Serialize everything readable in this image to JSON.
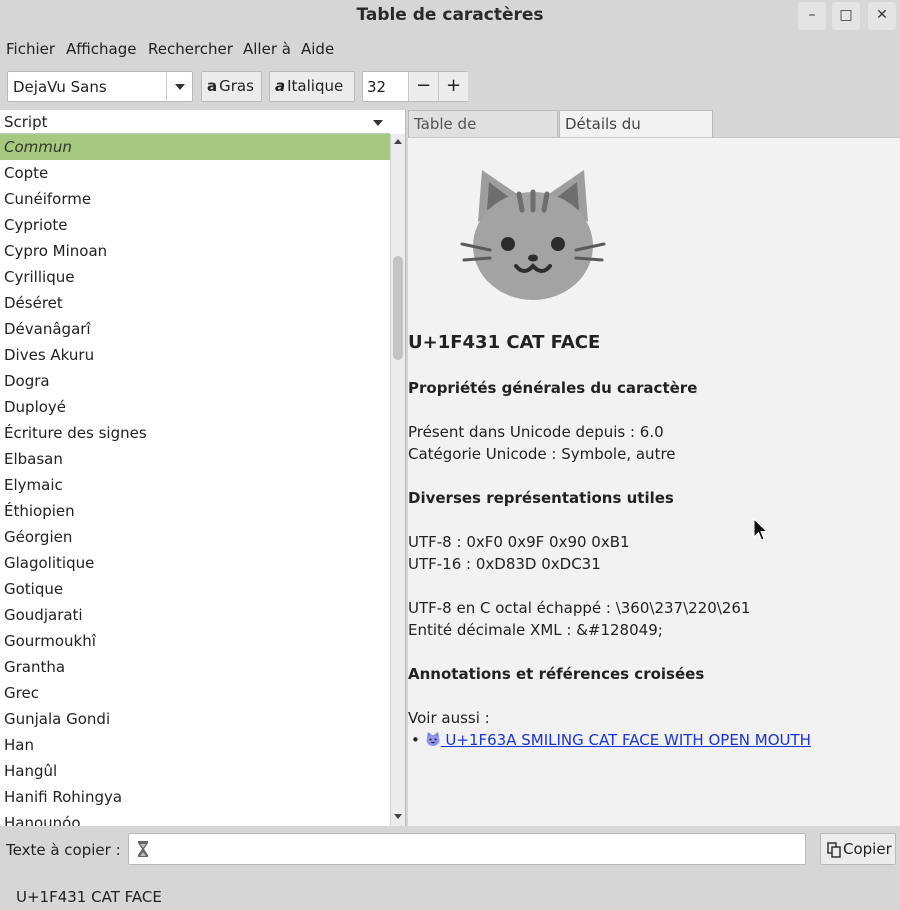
{
  "window": {
    "title": "Table de caractères",
    "controls": {
      "minimize": "–",
      "maximize": "□",
      "close": "✕"
    }
  },
  "menu": [
    "Fichier",
    "Affichage",
    "Rechercher",
    "Aller à",
    "Aide"
  ],
  "toolbar": {
    "font": "DejaVu Sans",
    "bold_label": "Gras",
    "italic_label": "Italique",
    "bold_icon_text": "a",
    "italic_icon_text": "a",
    "size": "32",
    "decrement": "−",
    "increment": "+"
  },
  "sidebar": {
    "header": "Script",
    "items": [
      "Commun",
      "Copte",
      "Cunéiforme",
      "Cypriote",
      "Cypro Minoan",
      "Cyrillique",
      "Déséret",
      "Dévanâgarî",
      "Dives Akuru",
      "Dogra",
      "Duployé",
      "Écriture des signes",
      "Elbasan",
      "Elymaic",
      "Éthiopien",
      "Géorgien",
      "Glagolitique",
      "Gotique",
      "Goudjarati",
      "Gourmoukhî",
      "Grantha",
      "Grec",
      "Gunjala Gondi",
      "Han",
      "Hangûl",
      "Hanifi Rohingya",
      "Hanounóo"
    ],
    "selected_index": 0,
    "selected_color": "#a7c880"
  },
  "tabs": [
    "Table de caractères",
    "Détails du caractère"
  ],
  "details": {
    "glyph_icon": "cat-face-icon",
    "char_title": "U+1F431 CAT FACE",
    "general_heading": "Propriétés générales du caractère",
    "unicode_since": "Présent dans Unicode depuis : 6.0",
    "unicode_category": "Catégorie Unicode : Symbole, autre",
    "reps_heading": "Diverses représentations utiles",
    "utf8": "UTF-8 : 0xF0 0x9F 0x90 0xB1",
    "utf16": "UTF-16 : 0xD83D 0xDC31",
    "utf8_octal": "UTF-8 en C octal échappé : \\360\\237\\220\\261",
    "xml_entity": "Entité décimale XML : &#128049;",
    "annot_heading": "Annotations et références croisées",
    "see_also_label": "Voir aussi :",
    "bullet": "•",
    "see_also_link": "U+1F63A SMILING CAT FACE WITH OPEN MOUTH",
    "link_color": "#1a33d6"
  },
  "bottom": {
    "copy_label": "Texte à copier :",
    "copy_value": "",
    "copy_button": "Copier",
    "status": "U+1F431 CAT FACE"
  }
}
